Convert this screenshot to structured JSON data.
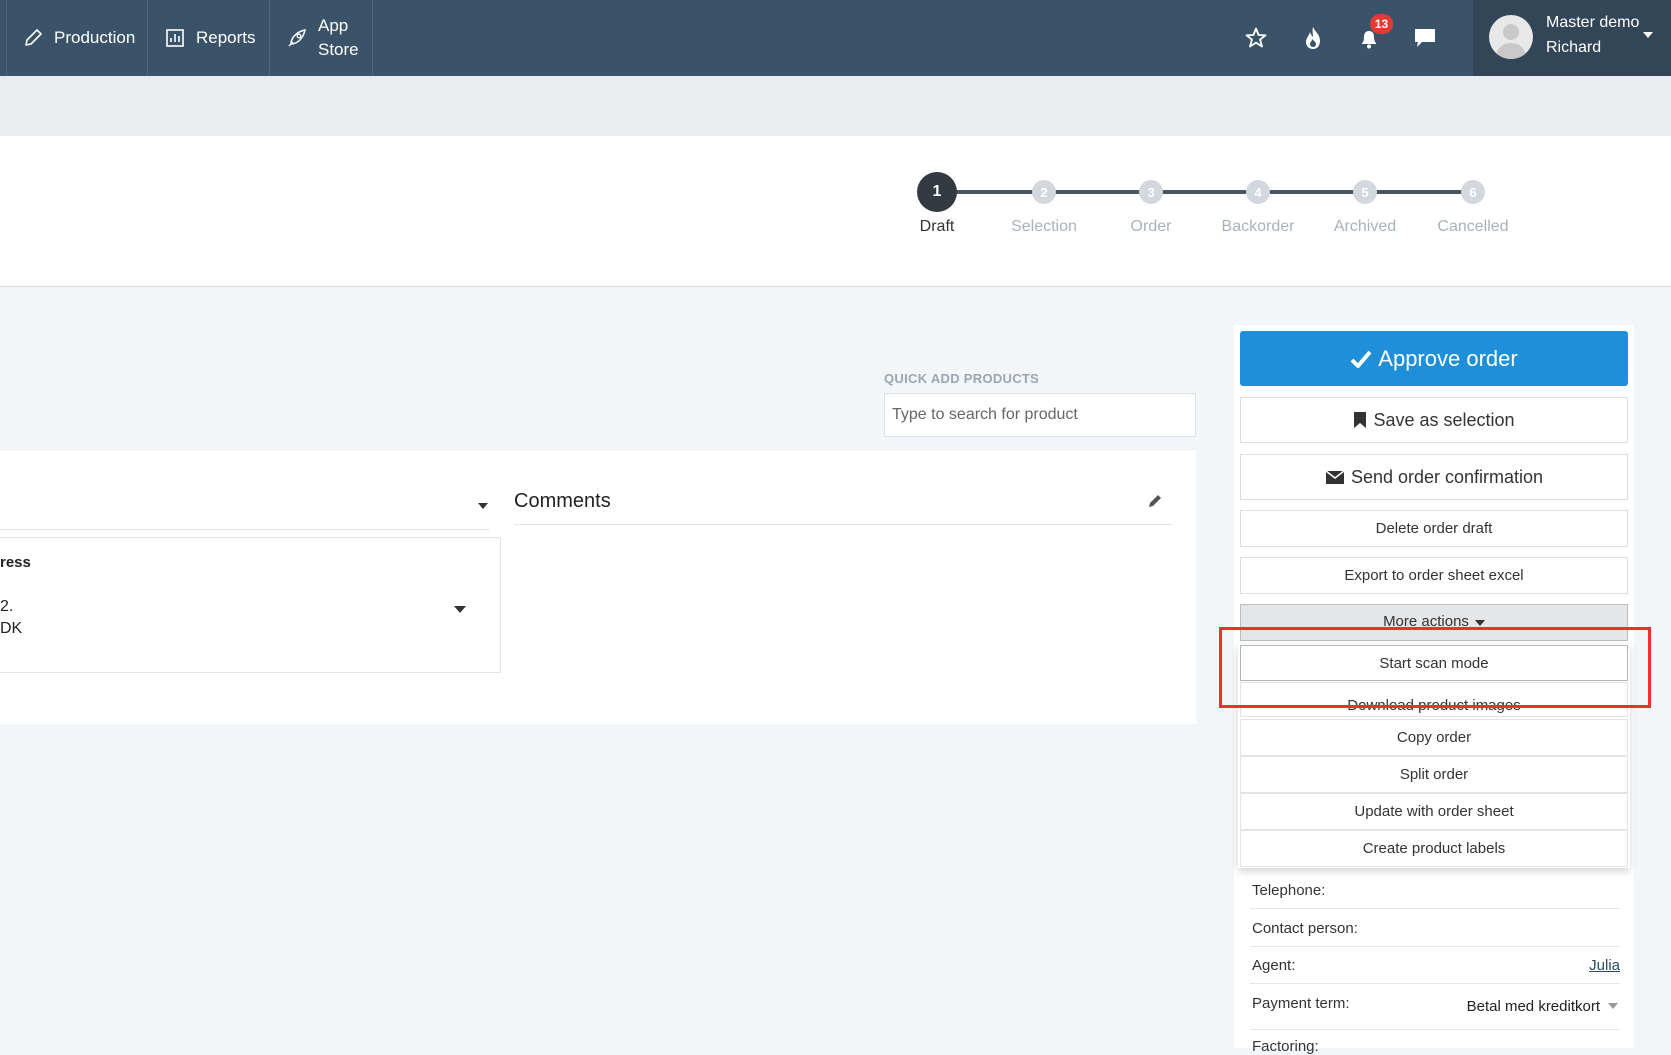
{
  "nav": {
    "items": [
      {
        "label": "Production",
        "icon": "pencil-icon"
      },
      {
        "label": "Reports",
        "icon": "report-icon"
      },
      {
        "label_line1": "App",
        "label_line2": "Store",
        "icon": "rocket-icon"
      }
    ],
    "icons": [
      "star-icon",
      "flame-icon",
      "bell-icon",
      "chat-icon"
    ],
    "notification_count": "13",
    "user": {
      "line1": "Master demo",
      "line2": "Richard"
    }
  },
  "stepper": {
    "steps": [
      {
        "num": "1",
        "label": "Draft",
        "active": true
      },
      {
        "num": "2",
        "label": "Selection",
        "active": false
      },
      {
        "num": "3",
        "label": "Order",
        "active": false
      },
      {
        "num": "4",
        "label": "Backorder",
        "active": false
      },
      {
        "num": "5",
        "label": "Archived",
        "active": false
      },
      {
        "num": "6",
        "label": "Cancelled",
        "active": false
      }
    ]
  },
  "quick_add": {
    "label": "QUICK ADD PRODUCTS",
    "placeholder": "Type to search for product"
  },
  "address": {
    "heading": "ress",
    "line1": "2.",
    "line2": "DK"
  },
  "comments": {
    "title": "Comments"
  },
  "actions": {
    "approve": "Approve order",
    "save_selection": "Save as selection",
    "send_confirmation": "Send order confirmation",
    "delete_draft": "Delete order draft",
    "export_excel": "Export to order sheet excel",
    "more_actions": "More actions"
  },
  "more_menu": [
    "Start scan mode",
    "Download product images",
    "Copy order",
    "Split order",
    "Update with order sheet",
    "Create product labels"
  ],
  "info": {
    "telephone_label": "Telephone:",
    "contact_label": "Contact person:",
    "agent_label": "Agent:",
    "agent_value": "Julia",
    "payment_label": "Payment term:",
    "payment_value": "Betal med kreditkort",
    "factoring_label": "Factoring:"
  },
  "colors": {
    "nav_bg": "#3b5368",
    "primary": "#1e8fd8",
    "highlight": "#e8322d",
    "badge": "#e53935"
  }
}
